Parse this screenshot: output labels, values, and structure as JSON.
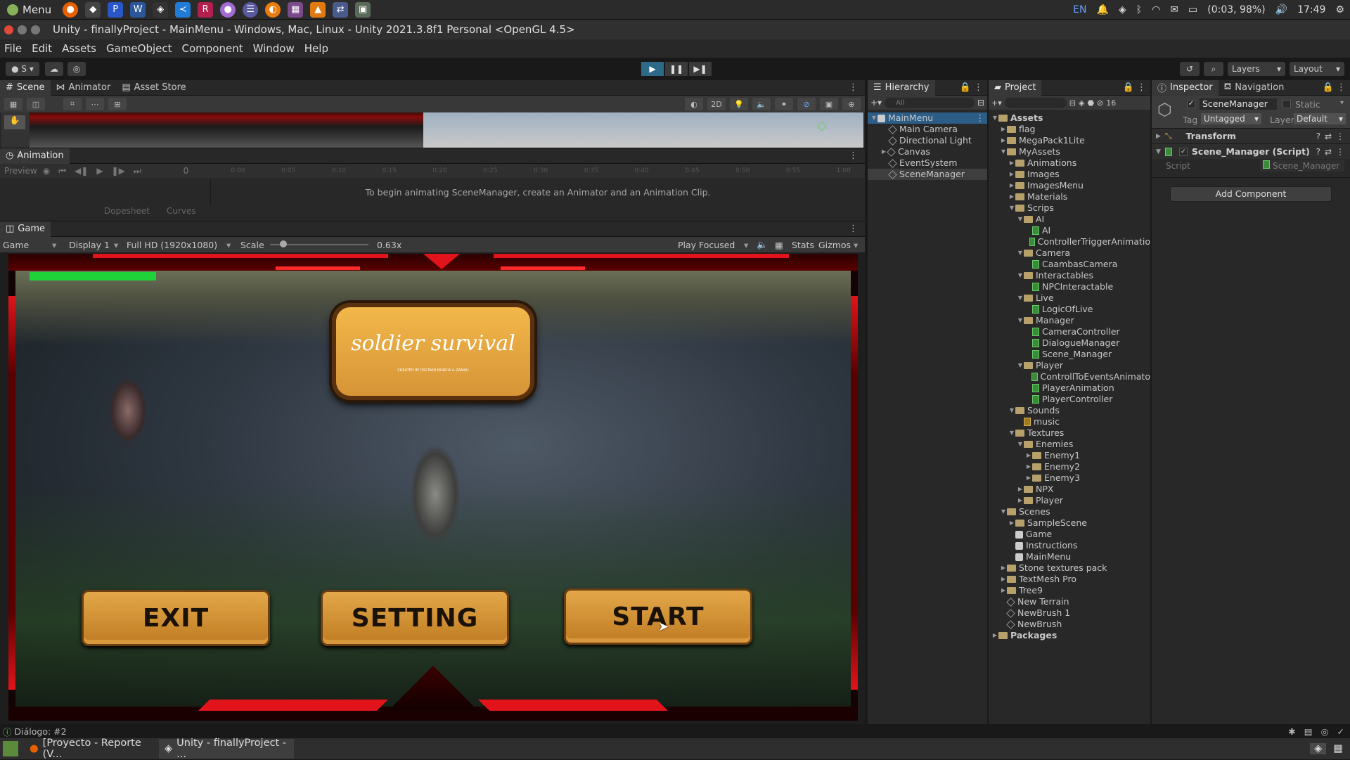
{
  "system": {
    "menu_label": "Menu",
    "tray": {
      "lang": "EN",
      "battery": "(0:03, 98%)",
      "clock": "17:49"
    }
  },
  "window": {
    "title": "Unity - finallyProject - MainMenu - Windows, Mac, Linux - Unity 2021.3.8f1 Personal <OpenGL 4.5>"
  },
  "menubar": [
    "File",
    "Edit",
    "Assets",
    "GameObject",
    "Component",
    "Window",
    "Help"
  ],
  "toolbar": {
    "account": "S",
    "layers": "Layers",
    "layout": "Layout"
  },
  "scene_tabs": [
    "Scene",
    "Animator",
    "Asset Store"
  ],
  "scene_tools": {
    "mode2d": "2D"
  },
  "animation": {
    "tab": "Animation",
    "preview": "Preview",
    "frame": "0",
    "ruler": [
      "0:00",
      "0:05",
      "0:10",
      "0:15",
      "0:20",
      "0:25",
      "0:30",
      "0:35",
      "0:40",
      "0:45",
      "0:50",
      "0:55",
      "1:00"
    ],
    "dopesheet": "Dopesheet",
    "curves": "Curves",
    "message": "To begin animating SceneManager, create an Animator and an Animation Clip."
  },
  "game_view": {
    "tab": "Game",
    "mode": "Game",
    "display": "Display 1",
    "resolution": "Full HD (1920x1080)",
    "scale_label": "Scale",
    "scale_value": "0.63x",
    "scale_fraction": 0.1,
    "play_focused": "Play Focused",
    "stats": "Stats",
    "gizmos": "Gizmos",
    "health_fraction": 1.0,
    "title": "soldier survival",
    "credit": "CREATED BY OSCMAN MURCIA & ZAMAU",
    "buttons": {
      "exit": "EXIT",
      "setting": "SETTING",
      "start": "START"
    }
  },
  "hierarchy": {
    "tab": "Hierarchy",
    "search_placeholder": "All",
    "root": "MainMenu",
    "items": [
      "Main Camera",
      "Directional Light",
      "Canvas",
      "EventSystem",
      "SceneManager"
    ]
  },
  "project": {
    "tab": "Project",
    "count": "16",
    "tree": [
      {
        "label": "Assets",
        "depth": 0,
        "kind": "folder",
        "open": true
      },
      {
        "label": "flag",
        "depth": 1,
        "kind": "folder"
      },
      {
        "label": "MegaPack1Lite",
        "depth": 1,
        "kind": "folder"
      },
      {
        "label": "MyAssets",
        "depth": 1,
        "kind": "folder",
        "open": true
      },
      {
        "label": "Animations",
        "depth": 2,
        "kind": "folder"
      },
      {
        "label": "Images",
        "depth": 2,
        "kind": "folder"
      },
      {
        "label": "ImagesMenu",
        "depth": 2,
        "kind": "folder"
      },
      {
        "label": "Materials",
        "depth": 2,
        "kind": "folder"
      },
      {
        "label": "Scrips",
        "depth": 2,
        "kind": "folder",
        "open": true
      },
      {
        "label": "AI",
        "depth": 3,
        "kind": "folder",
        "open": true
      },
      {
        "label": "AI",
        "depth": 4,
        "kind": "script"
      },
      {
        "label": "ControllerTriggerAnimatio",
        "depth": 4,
        "kind": "script"
      },
      {
        "label": "Camera",
        "depth": 3,
        "kind": "folder",
        "open": true
      },
      {
        "label": "CaambasCamera",
        "depth": 4,
        "kind": "script"
      },
      {
        "label": "Interactables",
        "depth": 3,
        "kind": "folder",
        "open": true
      },
      {
        "label": "NPCInteractable",
        "depth": 4,
        "kind": "script"
      },
      {
        "label": "Live",
        "depth": 3,
        "kind": "folder",
        "open": true
      },
      {
        "label": "LogicOfLive",
        "depth": 4,
        "kind": "script"
      },
      {
        "label": "Manager",
        "depth": 3,
        "kind": "folder",
        "open": true
      },
      {
        "label": "CameraController",
        "depth": 4,
        "kind": "script"
      },
      {
        "label": "DialogueManager",
        "depth": 4,
        "kind": "script"
      },
      {
        "label": "Scene_Manager",
        "depth": 4,
        "kind": "script"
      },
      {
        "label": "Player",
        "depth": 3,
        "kind": "folder",
        "open": true
      },
      {
        "label": "ControllToEventsAnimato",
        "depth": 4,
        "kind": "script"
      },
      {
        "label": "PlayerAnimation",
        "depth": 4,
        "kind": "script"
      },
      {
        "label": "PlayerController",
        "depth": 4,
        "kind": "script"
      },
      {
        "label": "Sounds",
        "depth": 2,
        "kind": "folder",
        "open": true
      },
      {
        "label": "music",
        "depth": 3,
        "kind": "audio"
      },
      {
        "label": "Textures",
        "depth": 2,
        "kind": "folder",
        "open": true
      },
      {
        "label": "Enemies",
        "depth": 3,
        "kind": "folder",
        "open": true
      },
      {
        "label": "Enemy1",
        "depth": 4,
        "kind": "folder"
      },
      {
        "label": "Enemy2",
        "depth": 4,
        "kind": "folder"
      },
      {
        "label": "Enemy3",
        "depth": 4,
        "kind": "folder"
      },
      {
        "label": "NPX",
        "depth": 3,
        "kind": "folder"
      },
      {
        "label": "Player",
        "depth": 3,
        "kind": "folder"
      },
      {
        "label": "Scenes",
        "depth": 1,
        "kind": "folder",
        "open": true
      },
      {
        "label": "SampleScene",
        "depth": 2,
        "kind": "folder"
      },
      {
        "label": "Game",
        "depth": 2,
        "kind": "scene"
      },
      {
        "label": "Instructions",
        "depth": 2,
        "kind": "scene"
      },
      {
        "label": "MainMenu",
        "depth": 2,
        "kind": "scene"
      },
      {
        "label": "Stone textures pack",
        "depth": 1,
        "kind": "folder"
      },
      {
        "label": "TextMesh Pro",
        "depth": 1,
        "kind": "folder"
      },
      {
        "label": "Tree9",
        "depth": 1,
        "kind": "folder"
      },
      {
        "label": "New Terrain",
        "depth": 1,
        "kind": "asset"
      },
      {
        "label": "NewBrush 1",
        "depth": 1,
        "kind": "asset"
      },
      {
        "label": "NewBrush",
        "depth": 1,
        "kind": "asset"
      },
      {
        "label": "Packages",
        "depth": 0,
        "kind": "folder"
      }
    ]
  },
  "inspector": {
    "tab": "Inspector",
    "tab2": "Navigation",
    "object_name": "SceneManager",
    "static_label": "Static",
    "tag_label": "Tag",
    "tag_value": "Untagged",
    "layer_label": "Layer",
    "layer_value": "Default",
    "transform": "Transform",
    "component": "Scene_Manager (Script)",
    "script_label": "Script",
    "script_value": "Scene_Manager",
    "add_component": "Add Component"
  },
  "statusbar": {
    "message": "Diálogo: #2"
  },
  "taskbar": {
    "items": [
      "[Proyecto - Reporte (V...",
      "Unity - finallyProject - ..."
    ]
  },
  "colors": {
    "play_accent": "#3b93c9",
    "frame_red": "#e0141a",
    "button_gold": "#d69437",
    "health": "#1fd23a"
  }
}
